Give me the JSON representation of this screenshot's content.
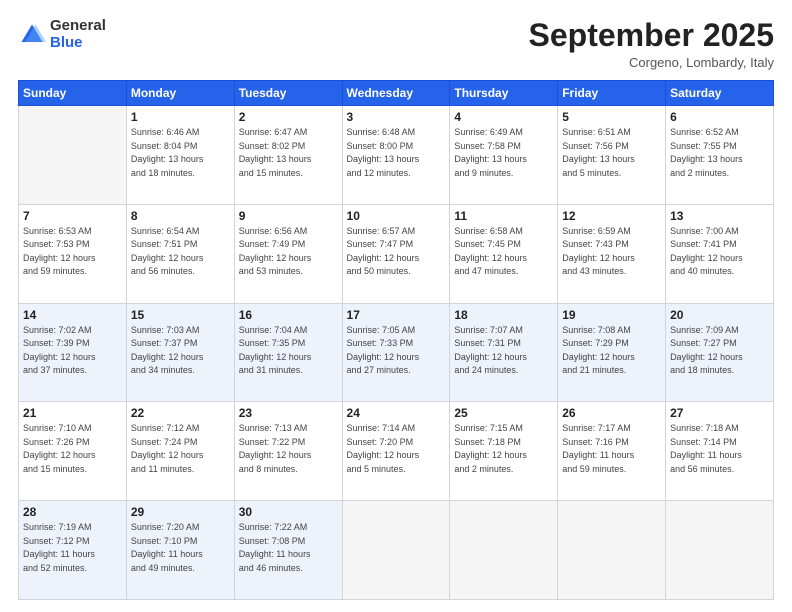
{
  "logo": {
    "general": "General",
    "blue": "Blue"
  },
  "title": "September 2025",
  "subtitle": "Corgeno, Lombardy, Italy",
  "days_header": [
    "Sunday",
    "Monday",
    "Tuesday",
    "Wednesday",
    "Thursday",
    "Friday",
    "Saturday"
  ],
  "weeks": [
    [
      {
        "day": "",
        "info": ""
      },
      {
        "day": "1",
        "info": "Sunrise: 6:46 AM\nSunset: 8:04 PM\nDaylight: 13 hours\nand 18 minutes."
      },
      {
        "day": "2",
        "info": "Sunrise: 6:47 AM\nSunset: 8:02 PM\nDaylight: 13 hours\nand 15 minutes."
      },
      {
        "day": "3",
        "info": "Sunrise: 6:48 AM\nSunset: 8:00 PM\nDaylight: 13 hours\nand 12 minutes."
      },
      {
        "day": "4",
        "info": "Sunrise: 6:49 AM\nSunset: 7:58 PM\nDaylight: 13 hours\nand 9 minutes."
      },
      {
        "day": "5",
        "info": "Sunrise: 6:51 AM\nSunset: 7:56 PM\nDaylight: 13 hours\nand 5 minutes."
      },
      {
        "day": "6",
        "info": "Sunrise: 6:52 AM\nSunset: 7:55 PM\nDaylight: 13 hours\nand 2 minutes."
      }
    ],
    [
      {
        "day": "7",
        "info": "Sunrise: 6:53 AM\nSunset: 7:53 PM\nDaylight: 12 hours\nand 59 minutes."
      },
      {
        "day": "8",
        "info": "Sunrise: 6:54 AM\nSunset: 7:51 PM\nDaylight: 12 hours\nand 56 minutes."
      },
      {
        "day": "9",
        "info": "Sunrise: 6:56 AM\nSunset: 7:49 PM\nDaylight: 12 hours\nand 53 minutes."
      },
      {
        "day": "10",
        "info": "Sunrise: 6:57 AM\nSunset: 7:47 PM\nDaylight: 12 hours\nand 50 minutes."
      },
      {
        "day": "11",
        "info": "Sunrise: 6:58 AM\nSunset: 7:45 PM\nDaylight: 12 hours\nand 47 minutes."
      },
      {
        "day": "12",
        "info": "Sunrise: 6:59 AM\nSunset: 7:43 PM\nDaylight: 12 hours\nand 43 minutes."
      },
      {
        "day": "13",
        "info": "Sunrise: 7:00 AM\nSunset: 7:41 PM\nDaylight: 12 hours\nand 40 minutes."
      }
    ],
    [
      {
        "day": "14",
        "info": "Sunrise: 7:02 AM\nSunset: 7:39 PM\nDaylight: 12 hours\nand 37 minutes."
      },
      {
        "day": "15",
        "info": "Sunrise: 7:03 AM\nSunset: 7:37 PM\nDaylight: 12 hours\nand 34 minutes."
      },
      {
        "day": "16",
        "info": "Sunrise: 7:04 AM\nSunset: 7:35 PM\nDaylight: 12 hours\nand 31 minutes."
      },
      {
        "day": "17",
        "info": "Sunrise: 7:05 AM\nSunset: 7:33 PM\nDaylight: 12 hours\nand 27 minutes."
      },
      {
        "day": "18",
        "info": "Sunrise: 7:07 AM\nSunset: 7:31 PM\nDaylight: 12 hours\nand 24 minutes."
      },
      {
        "day": "19",
        "info": "Sunrise: 7:08 AM\nSunset: 7:29 PM\nDaylight: 12 hours\nand 21 minutes."
      },
      {
        "day": "20",
        "info": "Sunrise: 7:09 AM\nSunset: 7:27 PM\nDaylight: 12 hours\nand 18 minutes."
      }
    ],
    [
      {
        "day": "21",
        "info": "Sunrise: 7:10 AM\nSunset: 7:26 PM\nDaylight: 12 hours\nand 15 minutes."
      },
      {
        "day": "22",
        "info": "Sunrise: 7:12 AM\nSunset: 7:24 PM\nDaylight: 12 hours\nand 11 minutes."
      },
      {
        "day": "23",
        "info": "Sunrise: 7:13 AM\nSunset: 7:22 PM\nDaylight: 12 hours\nand 8 minutes."
      },
      {
        "day": "24",
        "info": "Sunrise: 7:14 AM\nSunset: 7:20 PM\nDaylight: 12 hours\nand 5 minutes."
      },
      {
        "day": "25",
        "info": "Sunrise: 7:15 AM\nSunset: 7:18 PM\nDaylight: 12 hours\nand 2 minutes."
      },
      {
        "day": "26",
        "info": "Sunrise: 7:17 AM\nSunset: 7:16 PM\nDaylight: 11 hours\nand 59 minutes."
      },
      {
        "day": "27",
        "info": "Sunrise: 7:18 AM\nSunset: 7:14 PM\nDaylight: 11 hours\nand 56 minutes."
      }
    ],
    [
      {
        "day": "28",
        "info": "Sunrise: 7:19 AM\nSunset: 7:12 PM\nDaylight: 11 hours\nand 52 minutes."
      },
      {
        "day": "29",
        "info": "Sunrise: 7:20 AM\nSunset: 7:10 PM\nDaylight: 11 hours\nand 49 minutes."
      },
      {
        "day": "30",
        "info": "Sunrise: 7:22 AM\nSunset: 7:08 PM\nDaylight: 11 hours\nand 46 minutes."
      },
      {
        "day": "",
        "info": ""
      },
      {
        "day": "",
        "info": ""
      },
      {
        "day": "",
        "info": ""
      },
      {
        "day": "",
        "info": ""
      }
    ]
  ]
}
